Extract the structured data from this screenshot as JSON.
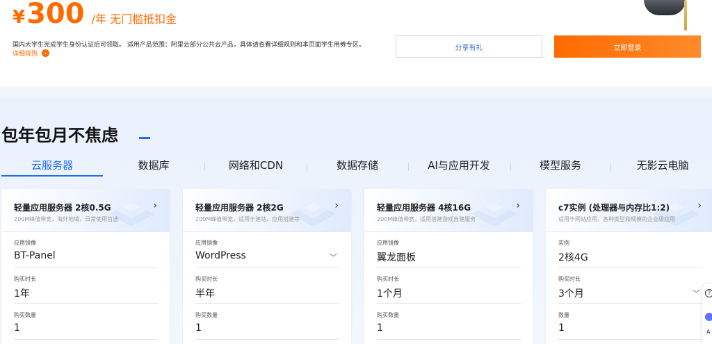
{
  "promo": {
    "currency": "¥",
    "amount": "300",
    "suffix": "/年 无门槛抵扣金",
    "description": "国内大学生完成学生身份认证后可领取。 适用产品范围：阿里云部分公共云产品，具体请查看详细规则和本页面学生用券专区。",
    "rules_link": "详细规则",
    "share_button": "分享有礼",
    "login_button": "立即登录"
  },
  "section": {
    "title": "包年包月不焦虑",
    "tabs": [
      {
        "label": "云服务器",
        "active": true
      },
      {
        "label": "数据库",
        "active": false
      },
      {
        "label": "网络和CDN",
        "active": false
      },
      {
        "label": "数据存储",
        "active": false
      },
      {
        "label": "AI与应用开发",
        "active": false
      },
      {
        "label": "模型服务",
        "active": false
      },
      {
        "label": "无影云电脑",
        "active": false
      }
    ]
  },
  "cards": [
    {
      "title": "轻量应用服务器 2核0.5G",
      "subtitle": "200M峰值带宽，海外地域，日常使用首选",
      "field1_label": "应用镜像",
      "field1_value": "BT-Panel",
      "field2_label": "购买时长",
      "field2_value": "1年",
      "field3_label": "购买数量",
      "field3_value": "1"
    },
    {
      "title": "轻量应用服务器 2核2G",
      "subtitle": "200M峰值带宽，适用于建站、应用搭建等",
      "field1_label": "应用镜像",
      "field1_value": "WordPress",
      "field2_label": "购买时长",
      "field2_value": "半年",
      "field3_label": "购买数量",
      "field3_value": "1"
    },
    {
      "title": "轻量应用服务器 4核16G",
      "subtitle": "200M峰值带宽，适用搭建游戏自建服务",
      "field1_label": "应用镜像",
      "field1_value": "翼龙面板",
      "field2_label": "购买时长",
      "field2_value": "1个月",
      "field3_label": "购买数量",
      "field3_value": "1"
    },
    {
      "title": "c7实例 (处理器与内存比1:2)",
      "subtitle": "适用于网站应用、各种类型和规模的企业级应用",
      "field1_label": "实例",
      "field1_value": "2核4G",
      "field2_label": "购买时长",
      "field2_value": "3个月",
      "field3_label": "数量",
      "field3_value": "1"
    }
  ],
  "side_widget": {
    "text": "A"
  },
  "colors": {
    "accent": "#ff6a00",
    "primary_blue": "#1f6bff"
  }
}
